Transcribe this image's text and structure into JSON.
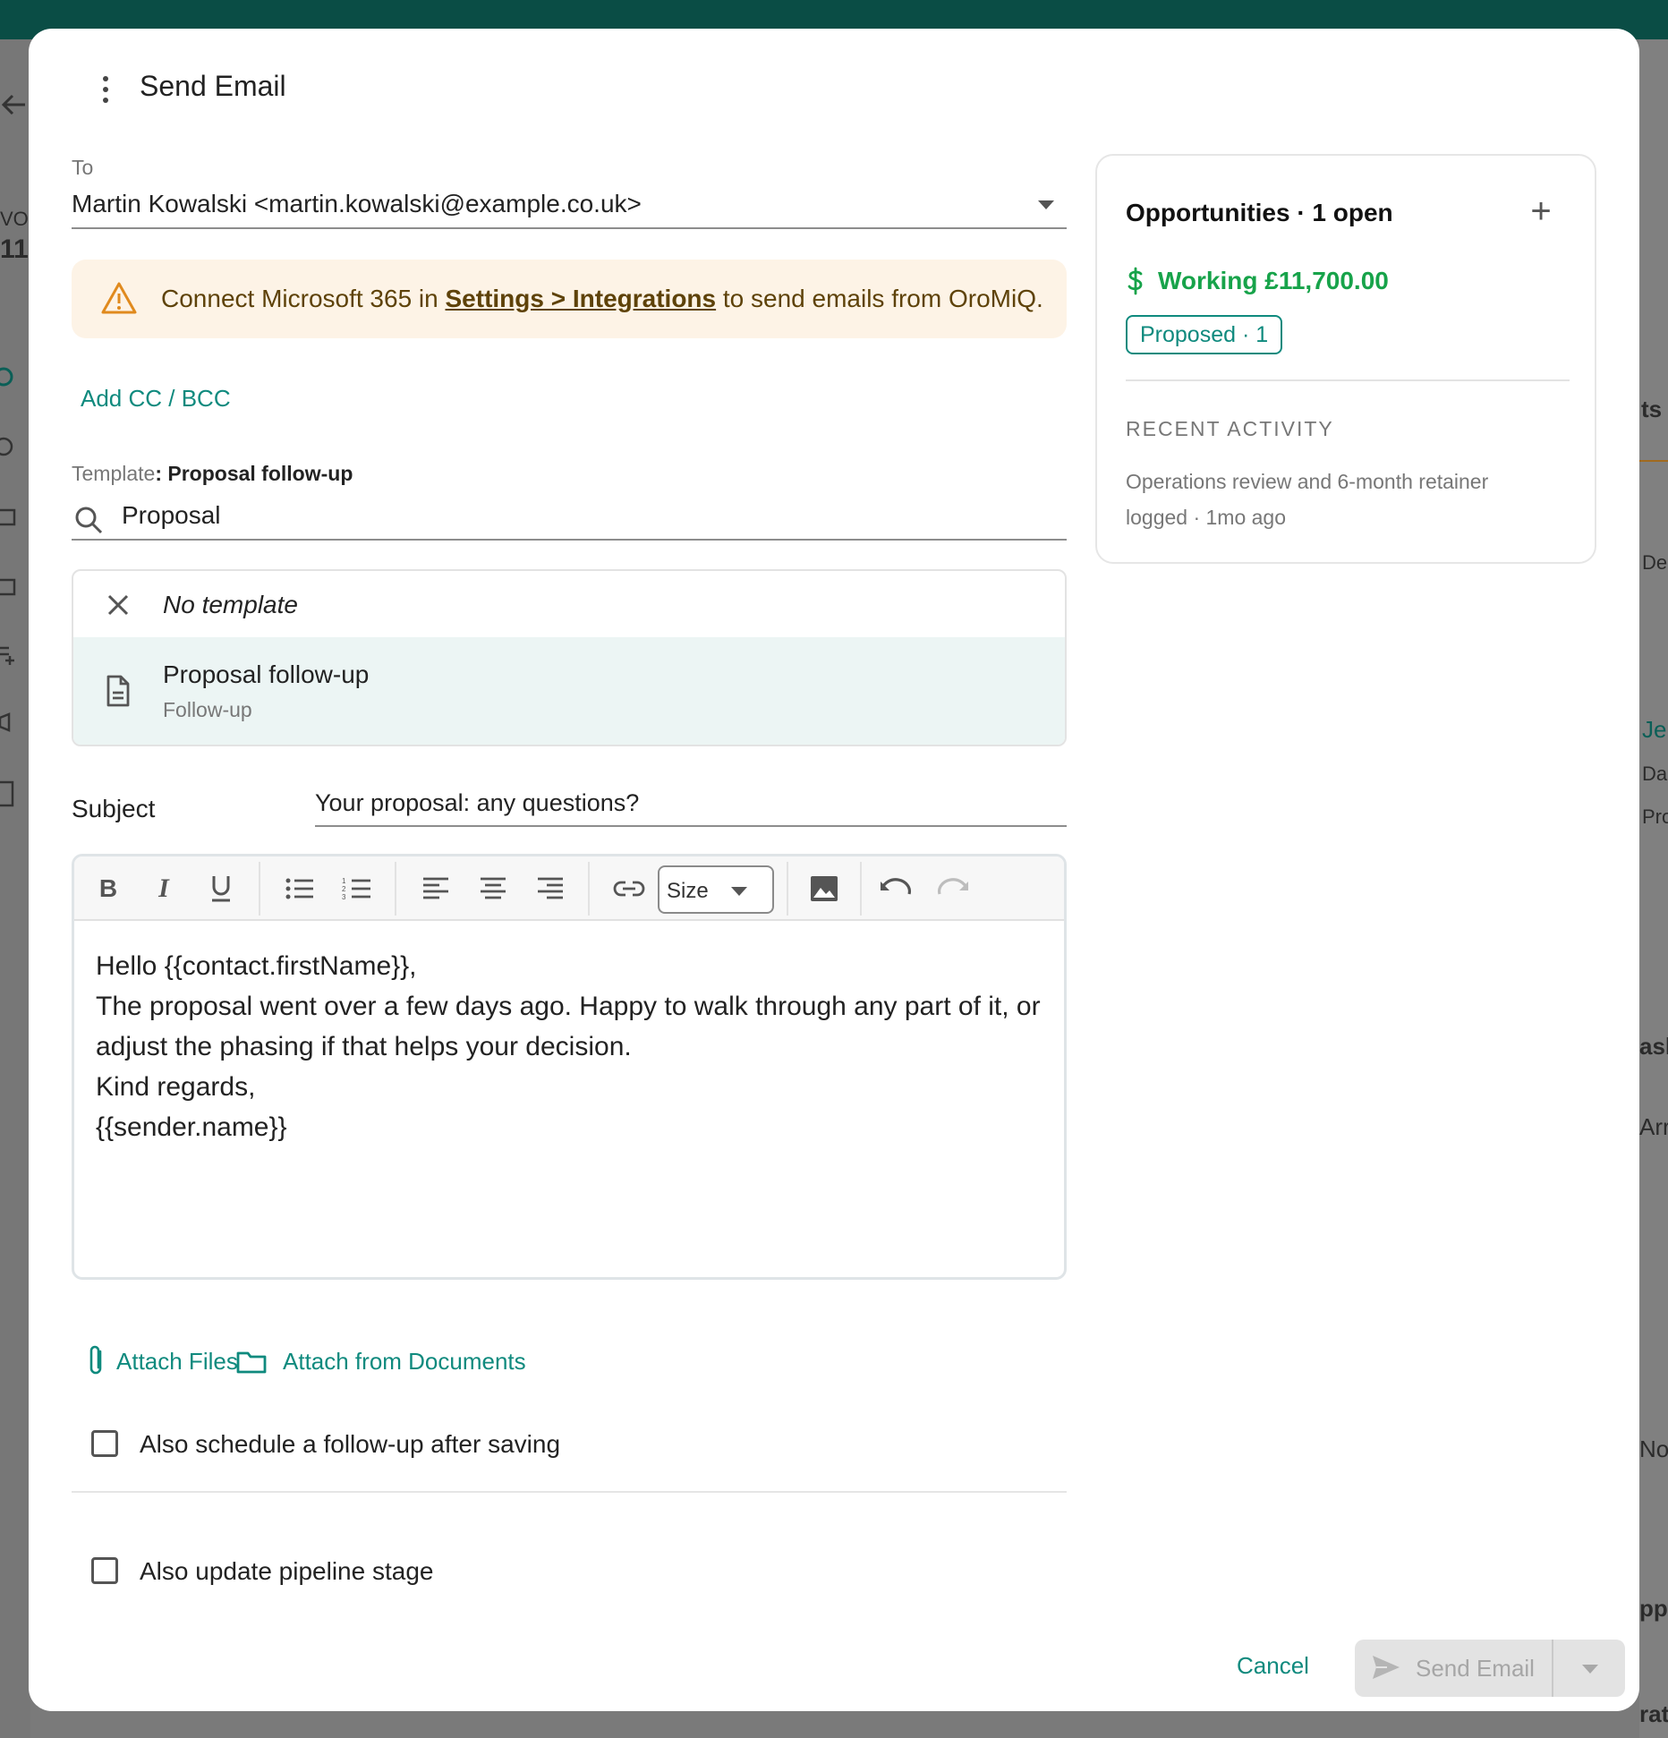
{
  "modal": {
    "title": "Send Email"
  },
  "to": {
    "label": "To",
    "value": "Martin Kowalski <martin.kowalski@example.co.uk>"
  },
  "alert": {
    "prefix": "Connect Microsoft 365 in ",
    "link": "Settings > Integrations",
    "suffix": " to send emails from OroMiQ."
  },
  "cc_link": "Add CC / BCC",
  "template": {
    "label": "Template",
    "selected": ": Proposal follow-up",
    "search_value": "Proposal",
    "none_option": "No template",
    "options": [
      {
        "title": "Proposal follow-up",
        "category": "Follow-up"
      }
    ]
  },
  "subject": {
    "label": "Subject",
    "value": "Your proposal: any questions?"
  },
  "toolbar": {
    "size_label": "Size"
  },
  "body": {
    "lines": [
      "Hello {{contact.firstName}},",
      "The proposal went over a few days ago. Happy to walk through any part of it, or adjust the phasing if that helps your decision.",
      "Kind regards,",
      "{{sender.name}}"
    ]
  },
  "attachments": {
    "files": "Attach Files",
    "documents": "Attach from Documents"
  },
  "checks": {
    "follow_up": "Also schedule a follow-up after saving",
    "pipeline": "Also update pipeline stage"
  },
  "footer": {
    "cancel": "Cancel",
    "send": "Send Email"
  },
  "card": {
    "title": "Opportunities · 1 open",
    "working": "Working £11,700.00",
    "badge": "Proposed · 1",
    "recent_heading": "RECENT ACTIVITY",
    "recent_text": "Operations review and 6-month retainer logged · 1mo ago"
  },
  "background": {
    "left_text_1": "VOR",
    "left_text_2": "11",
    "right_texts": [
      "ts",
      "De",
      "Je",
      "Da",
      "Pro",
      "ask",
      "Arr",
      "No",
      "pp",
      "rati"
    ]
  },
  "colors": {
    "accent": "#0f8a7e",
    "topbar": "#0a4d45",
    "success": "#17a34a",
    "warning_bg": "#fdf3e6",
    "warning_icon": "#e08a1e"
  }
}
